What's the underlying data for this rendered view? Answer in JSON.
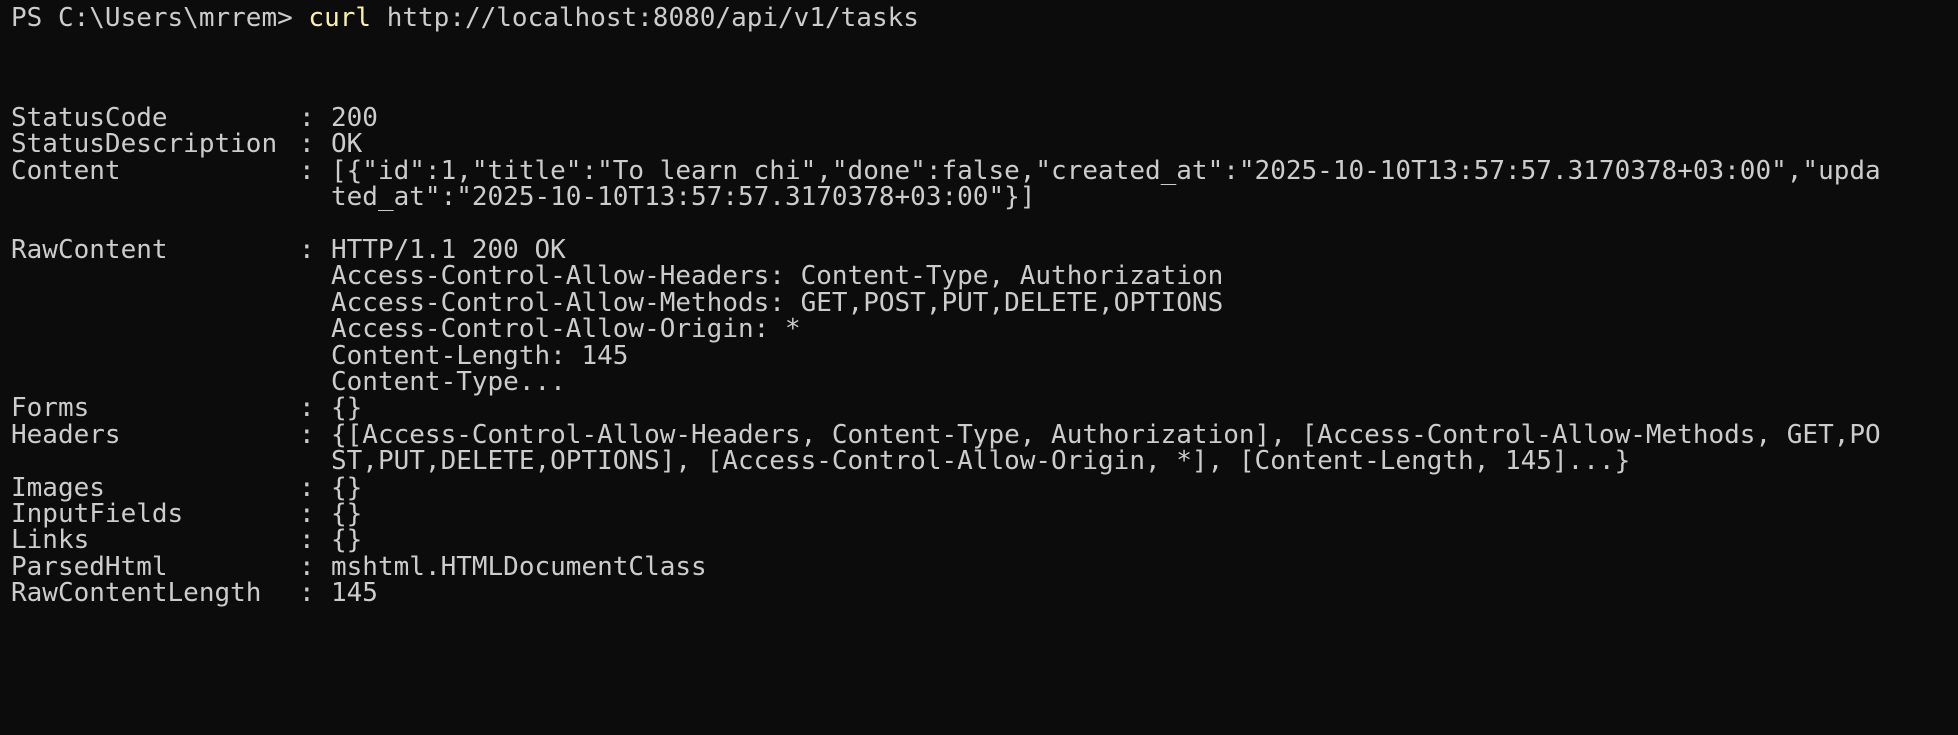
{
  "prompt": {
    "prefix": "PS C:\\Users\\mrrem> ",
    "command": "curl",
    "args": " http://localhost:8080/api/v1/tasks"
  },
  "separator": ":",
  "output": [
    {
      "key": "StatusCode",
      "lines": [
        "200"
      ]
    },
    {
      "key": "StatusDescription",
      "lines": [
        "OK"
      ]
    },
    {
      "key": "Content",
      "lines": [
        "[{\"id\":1,\"title\":\"To learn chi\",\"done\":false,\"created_at\":\"2025-10-10T13:57:57.3170378+03:00\",\"upda",
        "ted_at\":\"2025-10-10T13:57:57.3170378+03:00\"}]"
      ]
    },
    {
      "key": "RawContent",
      "lines": [
        "HTTP/1.1 200 OK",
        "Access-Control-Allow-Headers: Content-Type, Authorization",
        "Access-Control-Allow-Methods: GET,POST,PUT,DELETE,OPTIONS",
        "Access-Control-Allow-Origin: *",
        "Content-Length: 145",
        "Content-Type..."
      ]
    },
    {
      "key": "Forms",
      "lines": [
        "{}"
      ]
    },
    {
      "key": "Headers",
      "lines": [
        "{[Access-Control-Allow-Headers, Content-Type, Authorization], [Access-Control-Allow-Methods, GET,PO",
        "ST,PUT,DELETE,OPTIONS], [Access-Control-Allow-Origin, *], [Content-Length, 145]...}"
      ]
    },
    {
      "key": "Images",
      "lines": [
        "{}"
      ]
    },
    {
      "key": "InputFields",
      "lines": [
        "{}"
      ]
    },
    {
      "key": "Links",
      "lines": [
        "{}"
      ]
    },
    {
      "key": "ParsedHtml",
      "lines": [
        "mshtml.HTMLDocumentClass"
      ]
    },
    {
      "key": "RawContentLength",
      "lines": [
        "145"
      ]
    }
  ],
  "colors": {
    "background": "#0c0c0c",
    "text": "#cccccc",
    "command": "#f9f1a5"
  }
}
